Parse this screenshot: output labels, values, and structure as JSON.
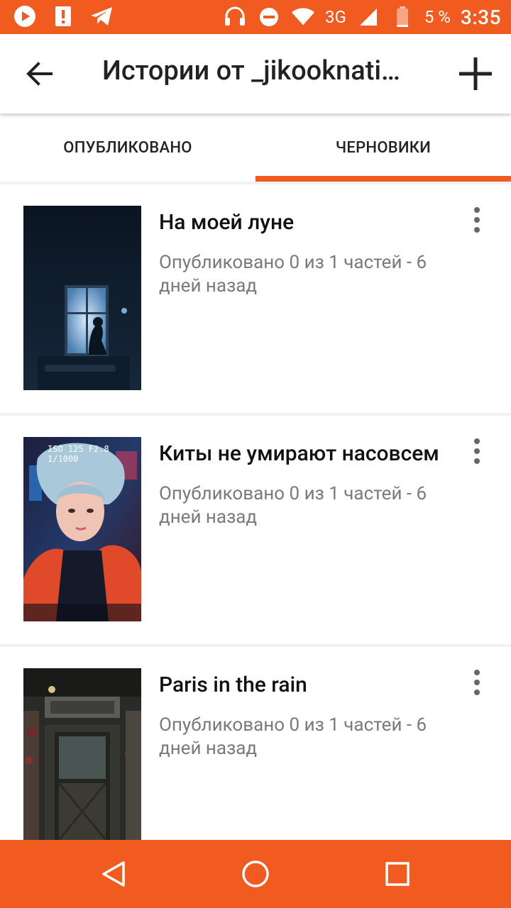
{
  "status_bar": {
    "left_icons": [
      "play-icon",
      "alert-icon",
      "telegram-icon"
    ],
    "right_icons": [
      "headset-icon",
      "do-not-disturb-icon",
      "wifi-icon"
    ],
    "network": "3G",
    "battery_percent": "5 %",
    "time": "3:35"
  },
  "app_bar": {
    "title": "Истории от _jikooknati…"
  },
  "tabs": [
    {
      "label": "ОПУБЛИКОВАНО",
      "selected": false
    },
    {
      "label": "ЧЕРНОВИКИ",
      "selected": true
    }
  ],
  "stories": [
    {
      "title": "На моей луне",
      "meta": "Опубликовано 0 из 1 частей - 6 дней назад"
    },
    {
      "title": "Киты не умирают насовсем",
      "meta": "Опубликовано 0 из 1 частей - 6 дней назад",
      "cover_text_top": "ISO 125  F2.8  1/1000"
    },
    {
      "title": "Paris in the rain",
      "meta": "Опубликовано 0 из 1 частей - 6 дней назад"
    }
  ],
  "colors": {
    "accent": "#f25b1f"
  }
}
